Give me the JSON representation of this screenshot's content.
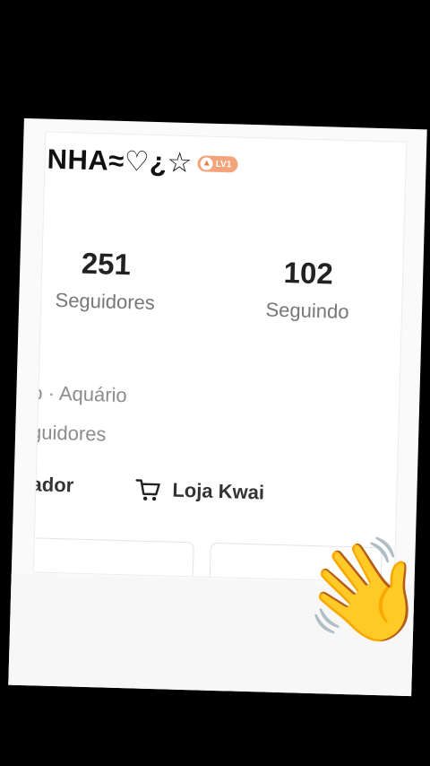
{
  "profile": {
    "name": "NHA≈♡¿☆",
    "level_badge": "LV1"
  },
  "stats": [
    {
      "value": "251",
      "label": "Seguidores"
    },
    {
      "value": "102",
      "label": "Seguindo"
    }
  ],
  "info": {
    "line1": "o · Aquário",
    "line2": "guidores"
  },
  "links": {
    "creator": "iador",
    "shop": "Loja Kwai"
  },
  "sticker": {
    "emoji": "👋",
    "name": "waving-hand"
  }
}
